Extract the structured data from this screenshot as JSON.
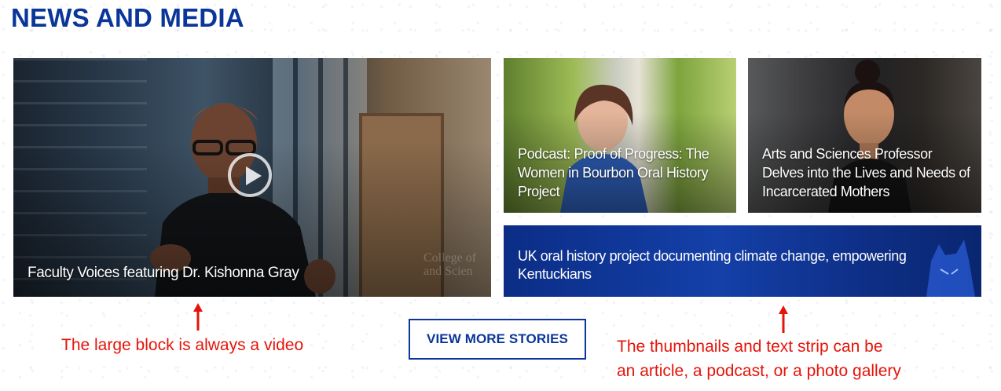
{
  "section": {
    "heading": "NEWS AND MEDIA"
  },
  "featured_video": {
    "title": "Faculty Voices featuring Dr. Kishonna Gray",
    "icon": "play-icon",
    "watermark_line1": "College of",
    "watermark_line2": "and Scien"
  },
  "thumbnails": [
    {
      "title": "Podcast: Proof of Progress: The Women in Bourbon Oral History Project"
    },
    {
      "title": "Arts and Sciences Professor Delves into the Lives and Needs of Incarcerated Mothers"
    }
  ],
  "text_strip": {
    "title": "UK oral history project documenting climate change, empowering Kentuckians"
  },
  "cta": {
    "label": "VIEW MORE STORIES"
  },
  "annotations": {
    "left_note": "The large block is always a video",
    "right_note_line1": "The thumbnails and text strip can be",
    "right_note_line2": "an article, a podcast, or a photo gallery"
  },
  "colors": {
    "brand_blue": "#0a3599",
    "annotation_red": "#e5140a"
  }
}
